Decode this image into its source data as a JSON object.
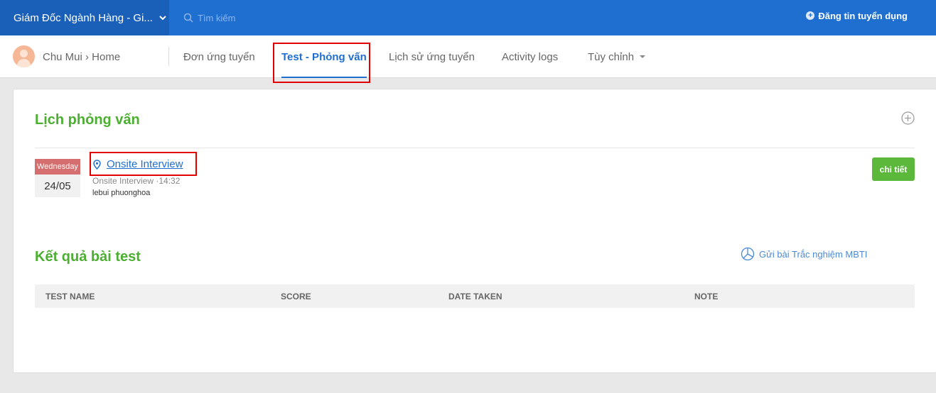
{
  "topbar": {
    "job_title": "Giám Đốc Ngành Hàng - Gi...",
    "search_placeholder": "Tìm kiếm",
    "post_job_label": "Đăng tin tuyển dụng"
  },
  "nav": {
    "breadcrumb": "Chu Mui › Home",
    "tabs": [
      {
        "label": "Đơn ứng tuyển"
      },
      {
        "label": "Test - Phỏng vấn"
      },
      {
        "label": "Lịch sử ứng tuyển"
      },
      {
        "label": "Activity logs"
      },
      {
        "label": "Tùy chỉnh"
      }
    ]
  },
  "interviews": {
    "title": "Lịch phỏng vấn",
    "item": {
      "day": "Wednesday",
      "date": "24/05",
      "name": "Onsite Interview",
      "meta": "Onsite Interview ·14:32",
      "participants": "lebui phuonghoa",
      "detail_label": "chi tiết"
    }
  },
  "tests": {
    "title": "Kết quả bài test",
    "mbti_label": "Gửi bài Trắc nghiệm MBTI",
    "columns": [
      "TEST NAME",
      "SCORE",
      "DATE TAKEN",
      "NOTE"
    ]
  },
  "colors": {
    "brand_blue": "#1f6fd1",
    "section_green": "#4caf32",
    "date_red": "#d56e6e",
    "button_green": "#5cb83b",
    "annotation_red": "#e00000"
  }
}
